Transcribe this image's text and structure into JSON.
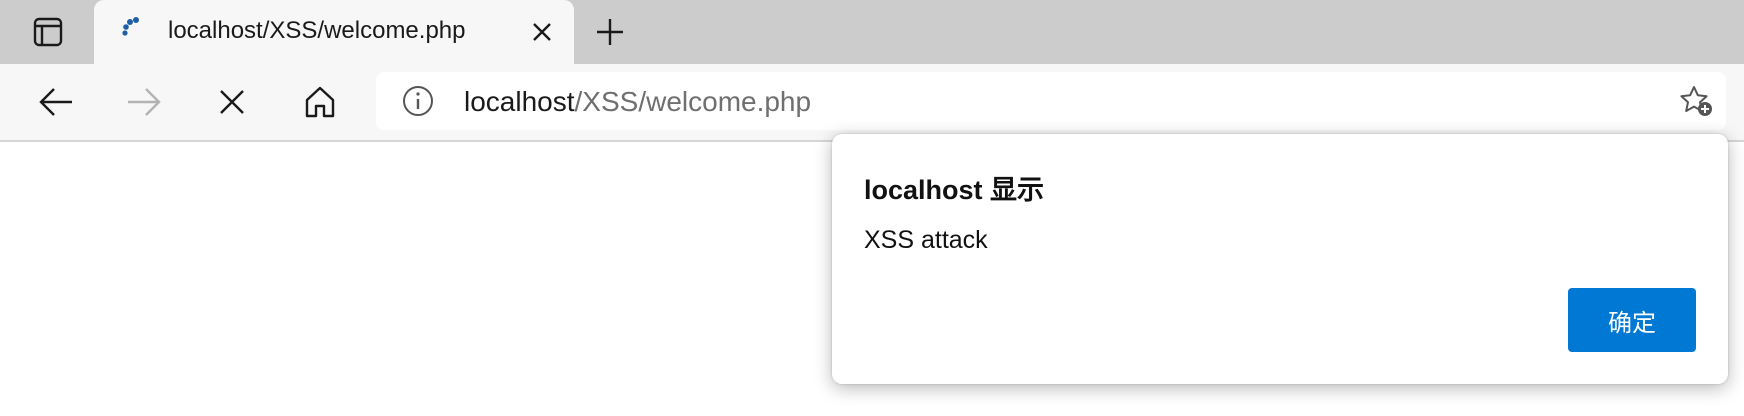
{
  "tab": {
    "title": "localhost/XSS/welcome.php"
  },
  "addressbar": {
    "host": "localhost",
    "path": "/XSS/welcome.php"
  },
  "dialog": {
    "title": "localhost 显示",
    "message": "XSS attack",
    "ok_label": "确定"
  },
  "colors": {
    "accent": "#0078d4",
    "tabstrip": "#cccccc",
    "toolbar": "#f7f7f7"
  },
  "icons": {
    "tab_actions": "tab-actions-icon",
    "favicon": "loading-spinner-icon",
    "tab_close": "close-icon",
    "new_tab": "plus-icon",
    "back": "arrow-left-icon",
    "forward": "arrow-right-icon",
    "stop": "close-icon",
    "home": "home-icon",
    "site_info": "info-icon",
    "favorites": "star-add-icon"
  }
}
